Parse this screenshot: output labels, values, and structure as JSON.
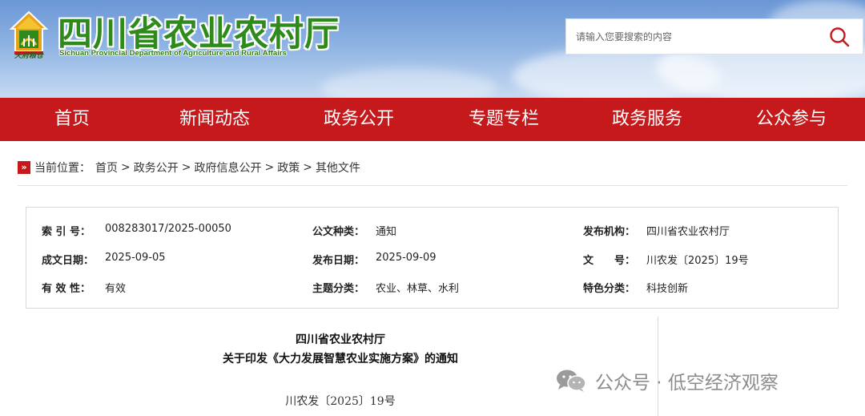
{
  "header": {
    "title": "四川省农业农村厅",
    "subtitle": "Sichuan Provincial Department of Agriculture and Rural Affairs",
    "emblem_caption": "天府粮仓",
    "search_placeholder": "请输入您要搜索的内容"
  },
  "nav": {
    "items": [
      {
        "label": "首页"
      },
      {
        "label": "新闻动态"
      },
      {
        "label": "政务公开"
      },
      {
        "label": "专题专栏"
      },
      {
        "label": "政务服务"
      },
      {
        "label": "公众参与"
      }
    ]
  },
  "breadcrumb": {
    "prefix": "当前位置：",
    "items": [
      "首页",
      "政务公开",
      "政府信息公开",
      "政策",
      "其他文件"
    ],
    "separator": ">"
  },
  "info": {
    "index_label": "索 引 号：",
    "index_value": "008283017/2025-00050",
    "type_label": "公文种类：",
    "type_value": "通知",
    "org_label": "发布机构：",
    "org_value": "四川省农业农村厅",
    "created_label": "成文日期：",
    "created_value": "2025-09-05",
    "published_label": "发布日期：",
    "published_value": "2025-09-09",
    "docno_label": "文　　号：",
    "docno_value": "川农发〔2025〕19号",
    "validity_label": "有 效 性：",
    "validity_value": "有效",
    "topic_label": "主题分类：",
    "topic_value": "农业、林草、水利",
    "feature_label": "特色分类：",
    "feature_value": "科技创新"
  },
  "article": {
    "title_line1": "四川省农业农村厅",
    "title_line2": "关于印发《大力发展智慧农业实施方案》的通知",
    "doc_number": "川农发〔2025〕19号"
  },
  "watermark": {
    "text": "公众号 · 低空经济观察"
  },
  "colors": {
    "nav_bg": "#c5191c",
    "title_green": "#2e8a1a"
  }
}
